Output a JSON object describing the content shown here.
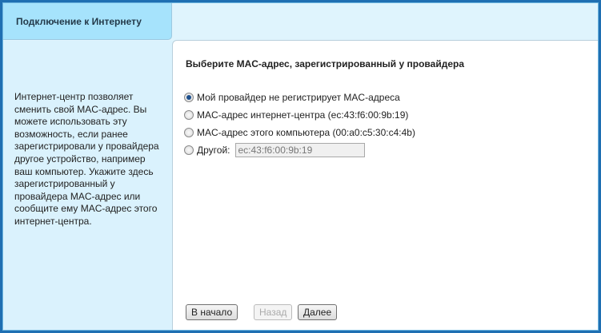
{
  "tab": {
    "title": "Подключение к Интернету"
  },
  "sidebar": {
    "help_text": "Интернет-центр позволяет сменить свой MAC-адрес. Вы можете использовать эту возможность, если ранее зарегистрировали у провайдера другое устройство, например ваш компьютер. Укажите здесь зарегистрированный у провайдера MAC-адрес или сообщите ему MAC-адрес этого интернет-центра."
  },
  "main": {
    "heading": "Выберите MAC-адрес, зарегистрированный у провайдера",
    "options": [
      {
        "label": "Мой провайдер не регистрирует MAC-адреса",
        "selected": true
      },
      {
        "label": "MAC-адрес интернет-центра (ec:43:f6:00:9b:19)",
        "selected": false
      },
      {
        "label": "MAC-адрес этого компьютера (00:a0:c5:30:c4:4b)",
        "selected": false
      },
      {
        "label": "Другой:",
        "selected": false
      }
    ],
    "other_mac_value": "ec:43:f6:00:9b:19"
  },
  "buttons": {
    "start": "В начало",
    "back": "Назад",
    "next": "Далее"
  }
}
